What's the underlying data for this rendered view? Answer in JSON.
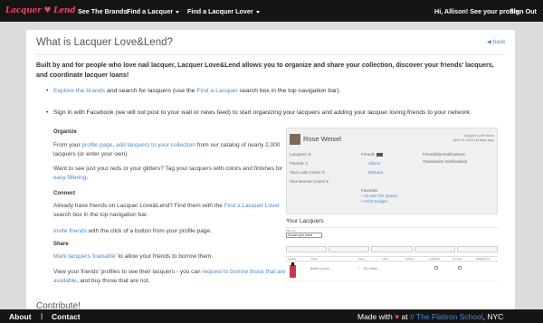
{
  "nav": {
    "logo": "Lacquer ♥ Lend",
    "brands": "See The Brands!",
    "find": "Find a Lacquer",
    "lover": "Find a Lacquer Lover",
    "greeting": "Hi, Allison! See your profile.",
    "signout": "Sign Out"
  },
  "page": {
    "title": "What is Lacquer Love&Lend?",
    "back": "back",
    "intro": "Built by and for people who love nail lacquer, Lacquer Love&Lend allows you to organize and share your collection, discover your friends' lacquers, and coordinate lacquer loans!",
    "bullet1": {
      "link1": "Explore the brands",
      "text1": " and search for lacquers (use the ",
      "link2": "Find a Lacquer",
      "text2": " search box in the top navigation bar)."
    },
    "bullet2": "Sign in with Facebook (we will not post to your wall or news feed) to start organizing your lacquers and adding your lacquer loving friends to your network:",
    "organize": {
      "heading": "Organize",
      "p1a": "From your ",
      "p1link1": "profile page",
      "p1b": ", ",
      "p1link2": "add lacquers to your collection",
      "p1c": " from our catalog of nearly 2,000 lacquers (or enter your own).",
      "p2a": "Want to see just your reds or your glitters? Tag your lacquers with colors and finishes for ",
      "p2link": "easy filtering",
      "p2b": "."
    },
    "connect": {
      "heading": "Connect",
      "p1a": "Already have friends on Lacquer Love&Lend? Find them with the ",
      "p1link": "Find a Lacquer Lover",
      "p1b": " search box in the top navigation bar.",
      "p2link": "Invite friends",
      "p2b": " with the click of a button from your profile page."
    },
    "share": {
      "heading": "Share",
      "p1link": "Mark lacquers 'loanable'",
      "p1b": " to allow your friends to borrow them.",
      "p2a": "View your friends' profiles to see their lacquers - you can ",
      "p2link": "request to borrow those that are available",
      "p2b": ", and buy those that are not."
    },
    "contribute": "Contribute!"
  },
  "mock": {
    "name": "Rose Weixel",
    "meta1": "Lacquer Lover Since",
    "meta2": "April 13, 2015 (18 days ago)",
    "lacquers": "Lacquers: 5",
    "friends_count": "Friends: 2",
    "loan_count": "Your Loan Count: 6",
    "borrow_count": "Your Borrow Count: 5",
    "friends_label": "Friends",
    "friend1": "Allison",
    "friend2": "Barbara",
    "notif1": "Friendship Notifications",
    "notif2": "Transaction Notifications",
    "favorites": "Favorites",
    "fav1": "• All Hail The Queen",
    "fav2": "• Artful Dodger",
    "your_lacquers": "Your Lacquers",
    "select_label": "Filter by",
    "select_value": "Choose your brand",
    "cols": [
      "Lacquer",
      "Brand",
      "",
      "Name",
      "Colors",
      "Finishes",
      "Loanable?",
      "On Loan?",
      "Edit/Remove"
    ],
    "row_brand": "Bullet London",
    "row_name": "BG Fallen"
  },
  "footer": {
    "about": "About",
    "sep": "|",
    "contact": "Contact",
    "made_with": "Made with ",
    "heart": "♥",
    "at": " at ",
    "school": "// The Flatiron School",
    "city": ", NYC"
  }
}
